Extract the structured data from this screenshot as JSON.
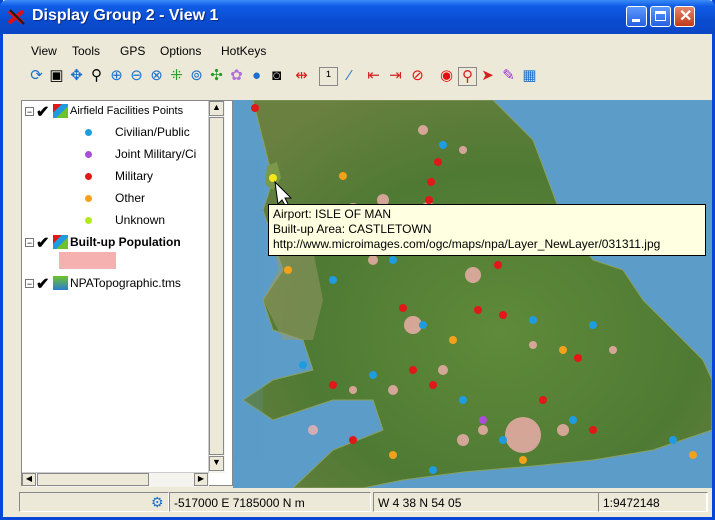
{
  "window": {
    "title": "Display Group 2 - View 1",
    "app_icon": "tntmips-icon"
  },
  "menu": [
    "View",
    "Tools",
    "GPS",
    "Options",
    "HotKeys"
  ],
  "legend": {
    "layers": [
      {
        "name": "Airfield Facilities Points",
        "categories": [
          {
            "label": "Civilian/Public",
            "color": "#1f9be0"
          },
          {
            "label": "Joint Military/Ci",
            "color": "#a94fd6"
          },
          {
            "label": "Military",
            "color": "#e01818"
          },
          {
            "label": "Other",
            "color": "#f2a11a"
          },
          {
            "label": "Unknown",
            "color": "#b4e81e"
          }
        ]
      },
      {
        "name": "Built-up Population",
        "swatch_color": "#f5b0b0"
      },
      {
        "name": "NPATopographic.tms"
      }
    ]
  },
  "tooltip": {
    "airport": "Airport: ISLE OF MAN",
    "builtup": "Built-up Area: CASTLETOWN",
    "url": "http://www.microimages.com/ogc/maps/npa/Layer_NewLayer/031311.jpg"
  },
  "status": {
    "coords": "-517000 E  7185000 N m",
    "latlon": "W 4 38  N 54 05",
    "scale": "1:9472148"
  }
}
